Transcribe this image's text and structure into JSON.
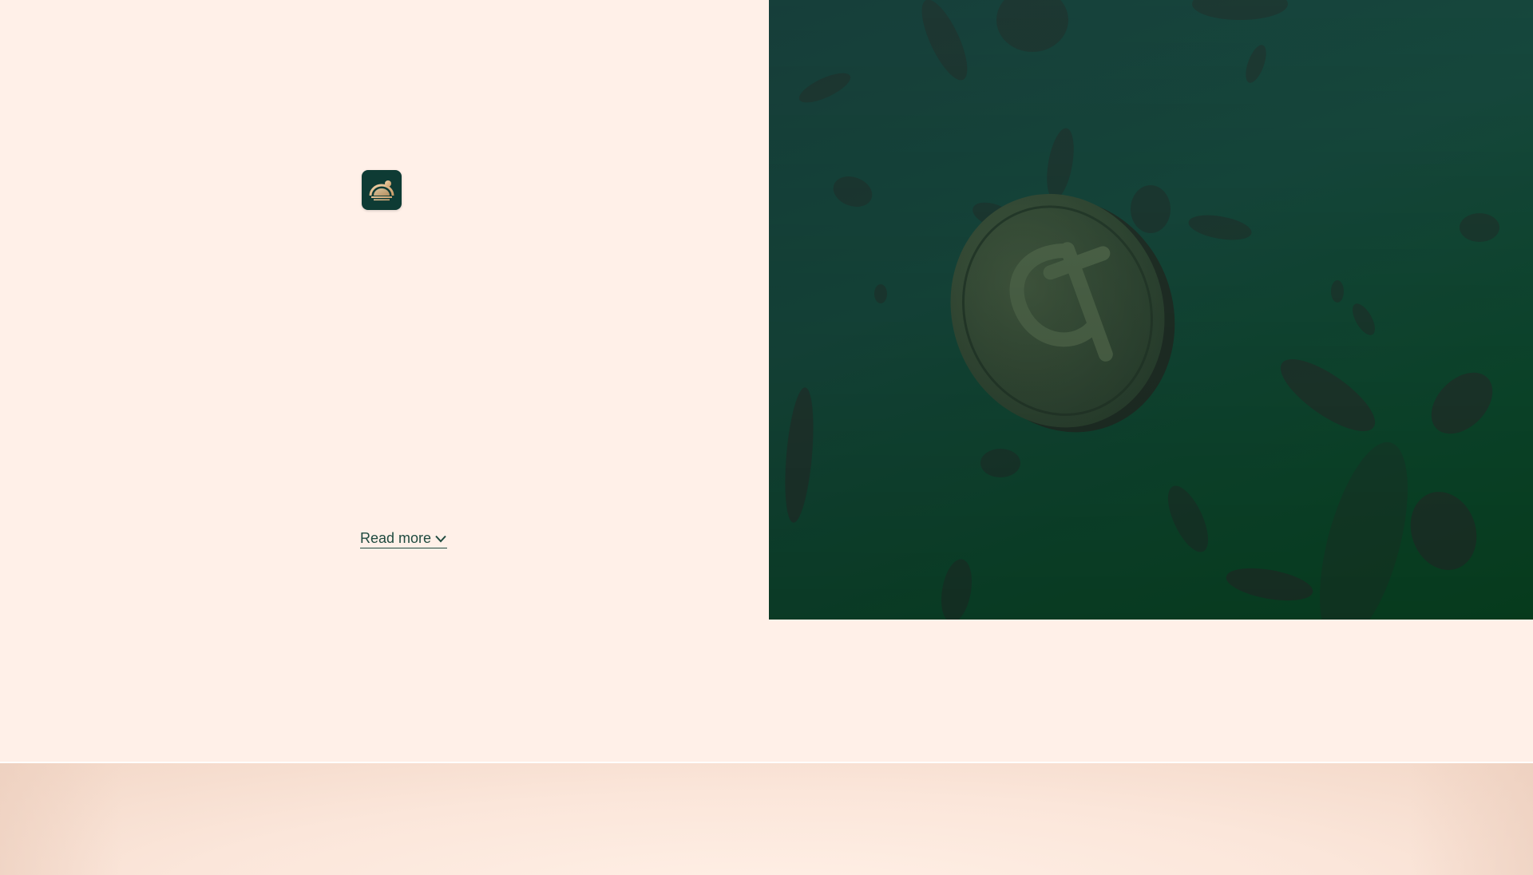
{
  "hero": {
    "read_more_label": "Read more",
    "app_icon_name": "app-logo-icon",
    "image_name": "falling-coins-image",
    "colors": {
      "background": "#fff0e8",
      "accent": "#0e3b34",
      "link": "#1f4a3f"
    }
  }
}
